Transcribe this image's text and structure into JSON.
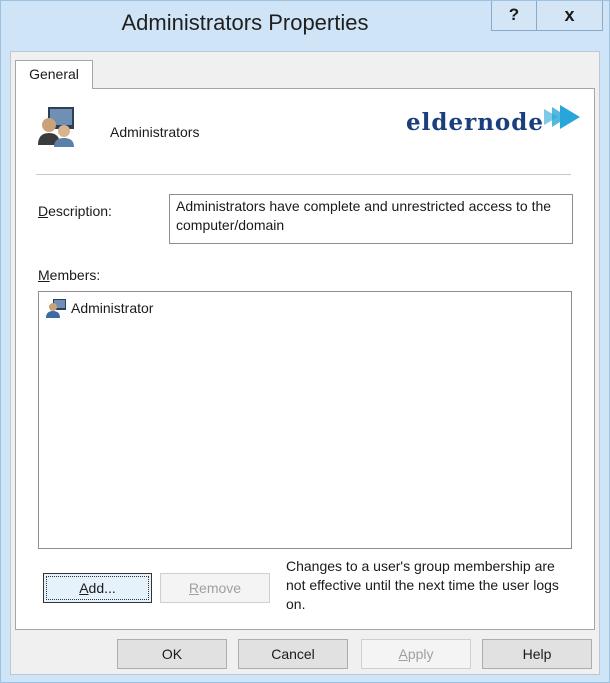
{
  "window": {
    "title": "Administrators Properties",
    "help_glyph": "?",
    "close_glyph": "x"
  },
  "tabs": [
    {
      "label": "General",
      "selected": true
    }
  ],
  "general": {
    "group_icon": "user-group-icon",
    "group_name": "Administrators",
    "watermark": "eldernode",
    "description_label": "Description:",
    "description_value": "Administrators have complete and unrestricted access to the computer/domain",
    "members_label": "Members:",
    "members": [
      {
        "name": "Administrator",
        "icon": "user-icon"
      }
    ],
    "add_label": "Add...",
    "remove_label": "Remove",
    "note": "Changes to a user's group membership are not effective until the next time the user logs on."
  },
  "footer": {
    "ok_label": "OK",
    "cancel_label": "Cancel",
    "apply_label": "Apply",
    "help_label": "Help"
  },
  "colors": {
    "title_bar": "#cfe4f6",
    "logo": "#1b3f7c",
    "logo_accent": "#29a6d9"
  }
}
